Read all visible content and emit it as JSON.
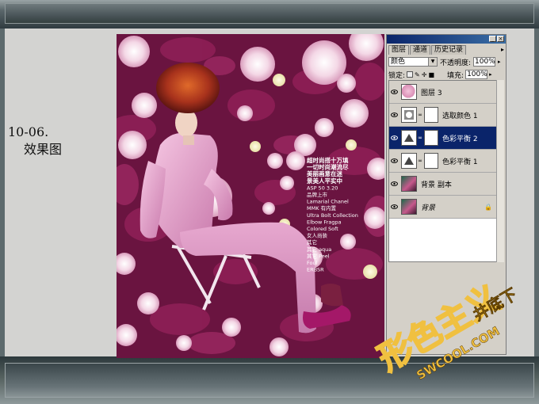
{
  "caption": {
    "line1": "10-06.",
    "line2": "效果图"
  },
  "palette": {
    "tabs": [
      "图层",
      "通道",
      "历史记录"
    ],
    "blend_mode": "颜色",
    "opacity_label": "不透明度:",
    "opacity_value": "100%",
    "lock_label": "锁定:",
    "fill_label": "填充:",
    "fill_value": "100%",
    "layers": [
      {
        "name": "图层 3",
        "selected": false
      },
      {
        "name": "选取颜色 1",
        "selected": false
      },
      {
        "name": "色彩平衡 2",
        "selected": true
      },
      {
        "name": "色彩平衡 1",
        "selected": false
      },
      {
        "name": "背景 副本",
        "selected": false
      },
      {
        "name": "背景",
        "selected": false
      }
    ]
  },
  "photo_text": {
    "lines": [
      "超时尚搭十万填",
      "一切时尚潮流尽",
      "美丽画意在迷",
      "景美人平实中",
      "ASP 50 3.20",
      "品牌上市",
      "Lamarial Chanel",
      "MMK 有内置",
      "Ultra Bolt Collection",
      "Elbow Fragpa",
      "Colored Soft",
      "女人尚装",
      "其它",
      "其它 aqua",
      "其它 Peel",
      "Foul",
      "ERBSR"
    ]
  },
  "watermark": {
    "main": "形色主义",
    "url": "SWCOOL.COM",
    "sub": "井底下"
  },
  "colors": {
    "selected_row": "#0a246a",
    "panel_bg": "#d4d0c8",
    "photo_base": "#5a0f34",
    "watermark": "#f0c040"
  }
}
